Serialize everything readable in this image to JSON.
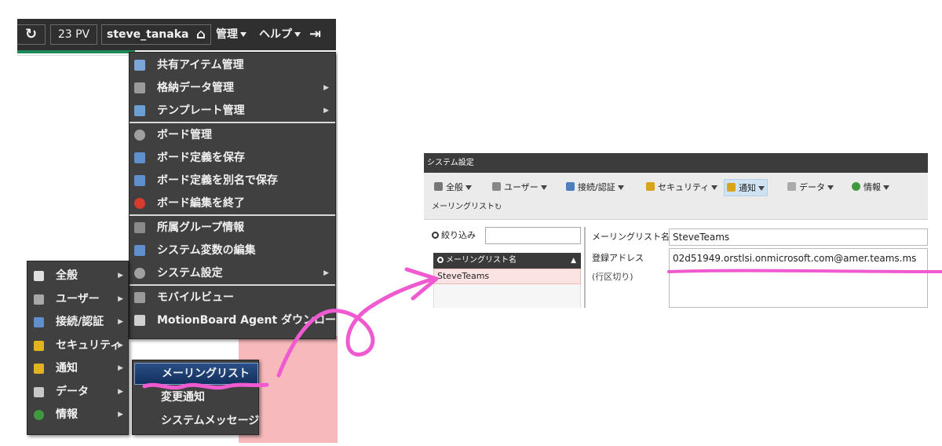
{
  "header": {
    "refresh_icon": "↻",
    "pv_label": "23 PV",
    "user_name": "steve_tanaka",
    "home_icon": "⌂",
    "admin_label": "管理",
    "help_label": "ヘルプ",
    "logout_icon": "⇥"
  },
  "admin_menu": {
    "items": [
      {
        "label": "共有アイテム管理",
        "icon": "share-items-icon",
        "color": "#7aa6d8",
        "submenu": false
      },
      {
        "label": "格納データ管理",
        "icon": "stored-data-icon",
        "color": "#9a9a9a",
        "submenu": true
      },
      {
        "label": "テンプレート管理",
        "icon": "template-icon",
        "color": "#6aa0d4",
        "submenu": true
      },
      {
        "label": "ボード管理",
        "icon": "gear-icon",
        "color": "#a0a0a0",
        "submenu": false
      },
      {
        "label": "ボード定義を保存",
        "icon": "save-icon",
        "color": "#5d90cc",
        "submenu": false
      },
      {
        "label": "ボード定義を別名で保存",
        "icon": "save-as-icon",
        "color": "#5d90cc",
        "submenu": false
      },
      {
        "label": "ボード編集を終了",
        "icon": "close-icon",
        "color": "#d83a2e",
        "submenu": false
      },
      {
        "label": "所属グループ情報",
        "icon": "group-icon",
        "color": "#8a8a8a",
        "submenu": false
      },
      {
        "label": "システム変数の編集",
        "icon": "variable-icon",
        "color": "#5d90cc",
        "submenu": false
      },
      {
        "label": "システム設定",
        "icon": "gear-icon",
        "color": "#a0a0a0",
        "submenu": true
      },
      {
        "label": "モバイルビュー",
        "icon": "mobile-icon",
        "color": "#9a9a9a",
        "submenu": false
      },
      {
        "label": "MotionBoard Agent ダウンロード",
        "icon": "agent-icon",
        "color": "#d0d0d0",
        "submenu": false
      }
    ]
  },
  "settings_menu": {
    "items": [
      {
        "label": "全般",
        "icon": "home-icon",
        "color": "#e0e0e0"
      },
      {
        "label": "ユーザー",
        "icon": "user-icon",
        "color": "#a8a8a8"
      },
      {
        "label": "接続/認証",
        "icon": "plug-icon",
        "color": "#5d90cc"
      },
      {
        "label": "セキュリティ",
        "icon": "shield-icon",
        "color": "#e3b21e"
      },
      {
        "label": "通知",
        "icon": "bell-icon",
        "color": "#e3b21e"
      },
      {
        "label": "データ",
        "icon": "data-icon",
        "color": "#c8c8c8"
      },
      {
        "label": "情報",
        "icon": "info-icon",
        "color": "#3f9a3f"
      }
    ]
  },
  "notify_menu": {
    "items": [
      {
        "label": "メーリングリスト",
        "active": true
      },
      {
        "label": "変更通知",
        "active": false
      },
      {
        "label": "システムメッセージ",
        "active": false
      }
    ]
  },
  "dialog": {
    "title": "システム設定",
    "tabs": [
      {
        "label": "全般",
        "icon": "home-icon",
        "active": false
      },
      {
        "label": "ユーザー",
        "icon": "user-icon",
        "active": false
      },
      {
        "label": "接続/認証",
        "icon": "plug-icon",
        "active": false
      },
      {
        "label": "セキュリティ",
        "icon": "shield-icon",
        "active": false
      },
      {
        "label": "通知",
        "icon": "bell-icon",
        "active": true
      },
      {
        "label": "データ",
        "icon": "data-icon",
        "active": false
      },
      {
        "label": "情報",
        "icon": "info-icon",
        "active": false
      }
    ],
    "section_title": "メーリングリスト",
    "refresh_icon": "↻",
    "filter_label": "絞り込み",
    "filter_value": "",
    "list_header": "メーリングリスト名",
    "sort_icon": "▲",
    "list_items": [
      "SteveTeams"
    ],
    "name_label": "メーリングリスト名",
    "name_value": "SteveTeams",
    "address_label": "登録アドレス",
    "address_hint": "(行区切り)",
    "address_value": "02d51949.orstlsi.onmicrosoft.com@amer.teams.ms"
  },
  "colors": {
    "annotation": "#f05ad0",
    "menu_bg": "#404040",
    "active_item": "#1d3f72",
    "selected_row": "#fbe3e3"
  }
}
